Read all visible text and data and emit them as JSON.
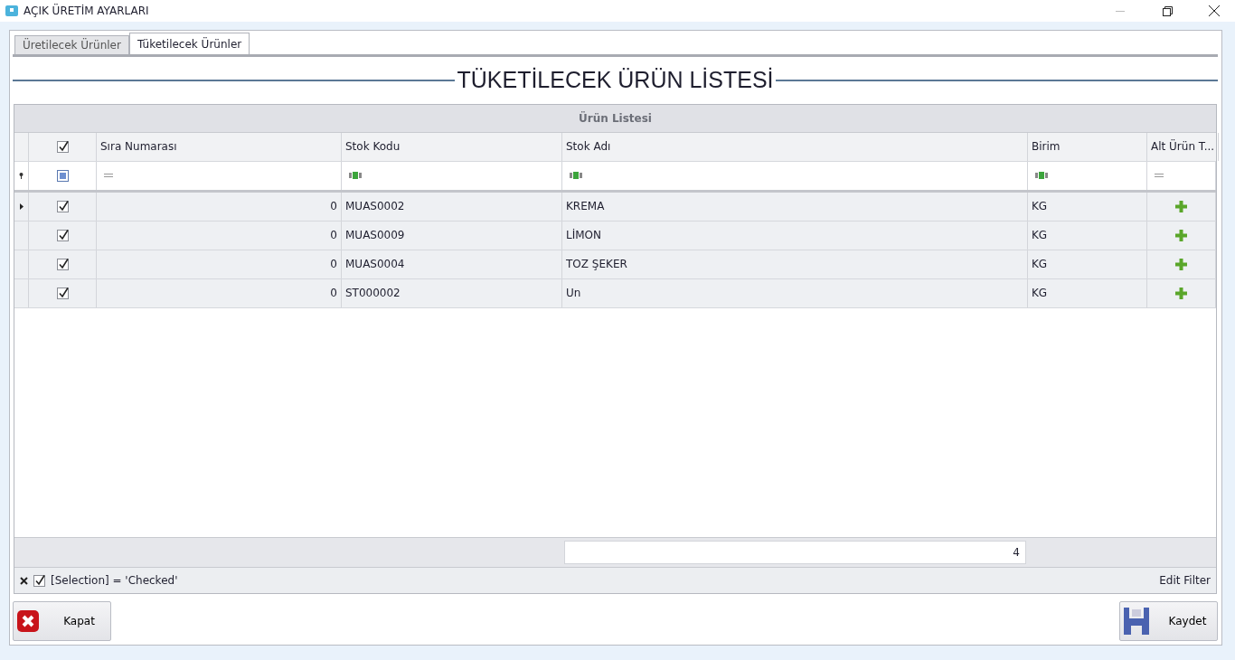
{
  "window": {
    "title": "AÇIK ÜRETİM AYARLARI"
  },
  "tabs": [
    {
      "label": "Üretilecek Ürünler",
      "selected": false
    },
    {
      "label": "Tüketilecek Ürünler",
      "selected": true
    }
  ],
  "heading": "TÜKETİLECEK ÜRÜN LİSTESİ",
  "grid": {
    "group_title": "Ürün Listesi",
    "select_all_checked": true,
    "filter_row_indeterminate": true,
    "columns": [
      {
        "label": "Sıra Numarası",
        "kind": "number"
      },
      {
        "label": "Stok Kodu",
        "kind": "text"
      },
      {
        "label": "Stok Adı",
        "kind": "text"
      },
      {
        "label": "Birim",
        "kind": "text"
      },
      {
        "label": "Alt Ürün T...",
        "kind": "action"
      }
    ],
    "rows": [
      {
        "checked": true,
        "current": true,
        "cells": [
          "0",
          "MUAS0002",
          "KREMA",
          "KG"
        ]
      },
      {
        "checked": true,
        "current": false,
        "cells": [
          "0",
          "MUAS0009",
          "LİMON",
          "KG"
        ]
      },
      {
        "checked": true,
        "current": false,
        "cells": [
          "0",
          "MUAS0004",
          "TOZ ŞEKER",
          "KG"
        ]
      },
      {
        "checked": true,
        "current": false,
        "cells": [
          "0",
          "ST000002",
          "Un",
          "KG"
        ]
      }
    ],
    "footer_count": "4",
    "filter": {
      "enabled": true,
      "text": "[Selection] = 'Checked'",
      "edit_label": "Edit Filter"
    }
  },
  "buttons": [
    {
      "kind": "close",
      "label": "Kapat"
    },
    {
      "kind": "save",
      "label": "Kaydet"
    }
  ]
}
